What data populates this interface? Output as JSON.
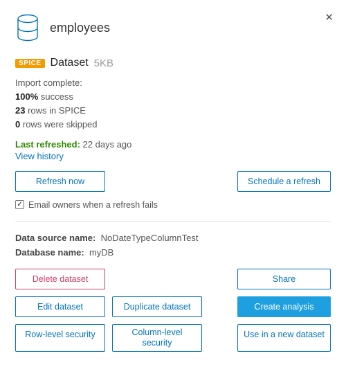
{
  "header": {
    "title": "employees",
    "closeGlyph": "✕"
  },
  "type": {
    "badge": "SPICE",
    "label": "Dataset",
    "size": "5KB"
  },
  "importStatus": {
    "heading": "Import complete:",
    "successPct": "100%",
    "successWord": "success",
    "rowsCount": "23",
    "rowsText": "rows in SPICE",
    "skippedCount": "0",
    "skippedText": "rows were skipped"
  },
  "refresh": {
    "label": "Last refreshed:",
    "value": "22 days ago",
    "historyLink": "View history",
    "refreshNow": "Refresh now",
    "schedule": "Schedule a refresh"
  },
  "email": {
    "checked": "✓",
    "label": "Email owners when a refresh fails"
  },
  "source": {
    "nameKey": "Data source name:",
    "nameVal": "NoDateTypeColumnTest",
    "dbKey": "Database name:",
    "dbVal": "myDB"
  },
  "actions": {
    "delete": "Delete dataset",
    "share": "Share",
    "edit": "Edit dataset",
    "duplicate": "Duplicate dataset",
    "create": "Create analysis",
    "rowSecurity": "Row-level security",
    "colSecurity": "Column-level\nsecurity",
    "useNew": "Use in a new dataset"
  }
}
